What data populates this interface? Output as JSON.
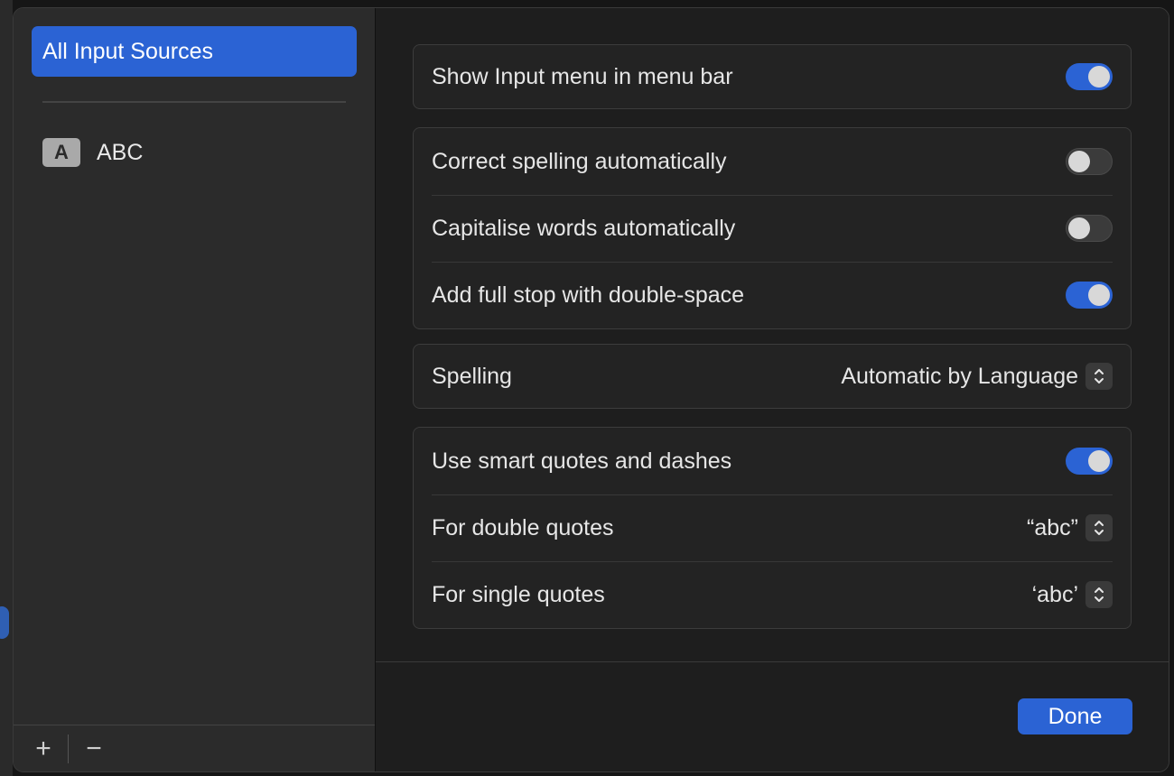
{
  "sidebar": {
    "selected_label": "All Input Sources",
    "sources": [
      {
        "badge": "A",
        "label": "ABC"
      }
    ],
    "add_label": "+",
    "remove_label": "−"
  },
  "groups": {
    "menu": {
      "show_input_menu": {
        "label": "Show Input menu in menu bar",
        "on": true
      }
    },
    "auto": {
      "correct_spelling": {
        "label": "Correct spelling automatically",
        "on": false
      },
      "capitalise": {
        "label": "Capitalise words automatically",
        "on": false
      },
      "full_stop": {
        "label": "Add full stop with double-space",
        "on": true
      }
    },
    "spelling": {
      "label": "Spelling",
      "value": "Automatic by Language"
    },
    "quotes": {
      "smart_quotes": {
        "label": "Use smart quotes and dashes",
        "on": true
      },
      "double_quotes": {
        "label": "For double quotes",
        "value": "“abc”"
      },
      "single_quotes": {
        "label": "For single quotes",
        "value": "‘abc’"
      }
    }
  },
  "footer": {
    "done_label": "Done"
  },
  "colors": {
    "accent": "#2b63d4",
    "sidebar_bg": "#2b2b2b",
    "main_bg": "#1e1e1e"
  }
}
